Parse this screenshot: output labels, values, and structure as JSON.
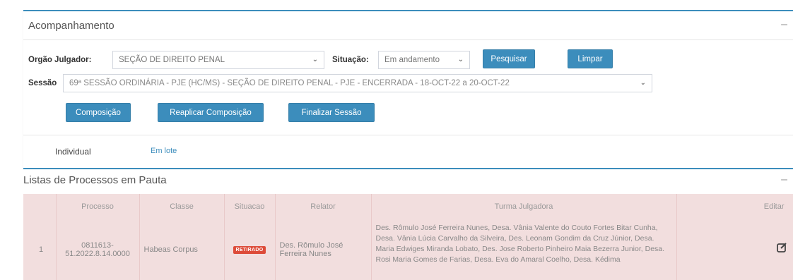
{
  "panel": {
    "title": "Acompanhamento",
    "collapse_icon": "minus-icon",
    "orgao_label": "Orgão Julgador:",
    "orgao_value": "SEÇÃO DE DIREITO PENAL",
    "situacao_label": "Situação:",
    "situacao_value": "Em andamento",
    "pesquisar_label": "Pesquisar",
    "limpar_label": "Limpar",
    "sessao_label": "Sessão",
    "sessao_value": "69ª SESSÃO ORDINÁRIA - PJE (HC/MS) - SEÇÃO DE DIREITO PENAL - PJE - ENCERRADA - 18-OCT-22 a 20-OCT-22",
    "composicao_label": "Composição",
    "reaplicar_label": "Reaplicar Composição",
    "finalizar_label": "Finalizar Sessão"
  },
  "tabs": [
    {
      "label": "Individual",
      "active": true
    },
    {
      "label": "Em lote",
      "active": false
    }
  ],
  "list": {
    "title": "Listas de Processos em Pauta",
    "collapse_icon": "minus-icon",
    "columns": [
      "",
      "Processo",
      "Classe",
      "Situacao",
      "Relator",
      "Turma Julgadora",
      "Editar"
    ],
    "rows": [
      {
        "num": "1",
        "processo": "0811613-51.2022.8.14.0000",
        "classe": "Habeas Corpus",
        "situacao": "RETIRADO",
        "relator": "Des. Rômulo José Ferreira Nunes",
        "turma": "Des. Rômulo José Ferreira Nunes, Desa. Vânia Valente do Couto Fortes Bitar Cunha, Desa. Vânia Lúcia Carvalho da Silveira, Des. Leonam Gondim da Cruz Júnior, Desa. Maria Edwiges Miranda Lobato, Des. Jose Roberto Pinheiro Maia Bezerra Junior, Desa. Rosi Maria Gomes de Farias, Desa. Eva do Amaral Coelho, Desa. Kédima",
        "edit_icon": "edit-icon"
      }
    ]
  },
  "colors": {
    "accent": "#3c8dbc",
    "row_bg": "#f2dede",
    "badge": "#dd4b39"
  }
}
